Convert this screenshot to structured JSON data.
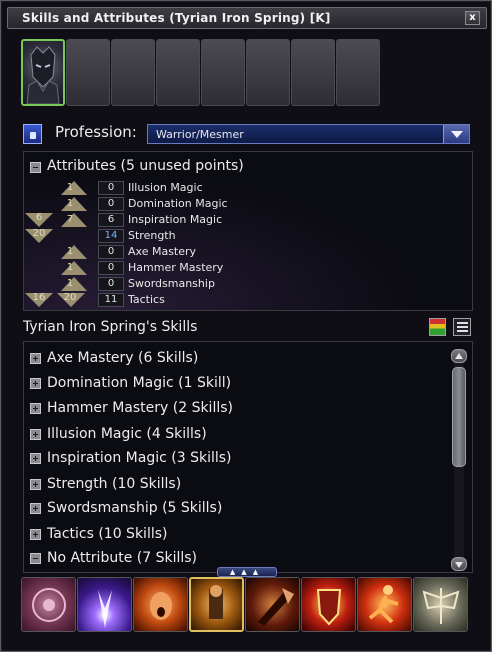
{
  "window": {
    "title": "Skills and Attributes (Tyrian Iron Spring) [K]",
    "close_label": "x"
  },
  "profession": {
    "label": "Profession:",
    "selected": "Warrior/Mesmer"
  },
  "attributes": {
    "header": "Attributes (5 unused points)",
    "rows": [
      {
        "bonus": "",
        "rank": "1",
        "value": "0",
        "name": "Illusion Magic",
        "highlight": false
      },
      {
        "bonus": "",
        "rank": "1",
        "value": "0",
        "name": "Domination Magic",
        "highlight": false
      },
      {
        "bonus": "6",
        "rank": "7",
        "value": "6",
        "name": "Inspiration Magic",
        "highlight": false
      },
      {
        "bonus": "20",
        "rank": "",
        "value": "14",
        "name": "Strength",
        "highlight": true
      },
      {
        "bonus": "",
        "rank": "1",
        "value": "0",
        "name": "Axe Mastery",
        "highlight": false
      },
      {
        "bonus": "",
        "rank": "1",
        "value": "0",
        "name": "Hammer Mastery",
        "highlight": false
      },
      {
        "bonus": "",
        "rank": "1",
        "value": "0",
        "name": "Swordsmanship",
        "highlight": false
      },
      {
        "bonus": "16",
        "rank": "20",
        "value": "11",
        "name": "Tactics",
        "highlight": false
      }
    ]
  },
  "skills": {
    "title": "Tyrian Iron Spring's Skills",
    "groups": [
      {
        "label": "Axe Mastery (6 Skills)",
        "expanded": false
      },
      {
        "label": "Domination Magic (1 Skill)",
        "expanded": false
      },
      {
        "label": "Hammer Mastery (2 Skills)",
        "expanded": false
      },
      {
        "label": "Illusion Magic (4 Skills)",
        "expanded": false
      },
      {
        "label": "Inspiration Magic (3 Skills)",
        "expanded": false
      },
      {
        "label": "Strength (10 Skills)",
        "expanded": false
      },
      {
        "label": "Swordsmanship (5 Skills)",
        "expanded": false
      },
      {
        "label": "Tactics (10 Skills)",
        "expanded": false
      },
      {
        "label": "No Attribute (7 Skills)",
        "expanded": true
      }
    ]
  },
  "colors": {
    "portrait_border": "#7bc85a",
    "highlight_value": "#7ab0ff",
    "profession_bg": "#1b2e6a"
  }
}
